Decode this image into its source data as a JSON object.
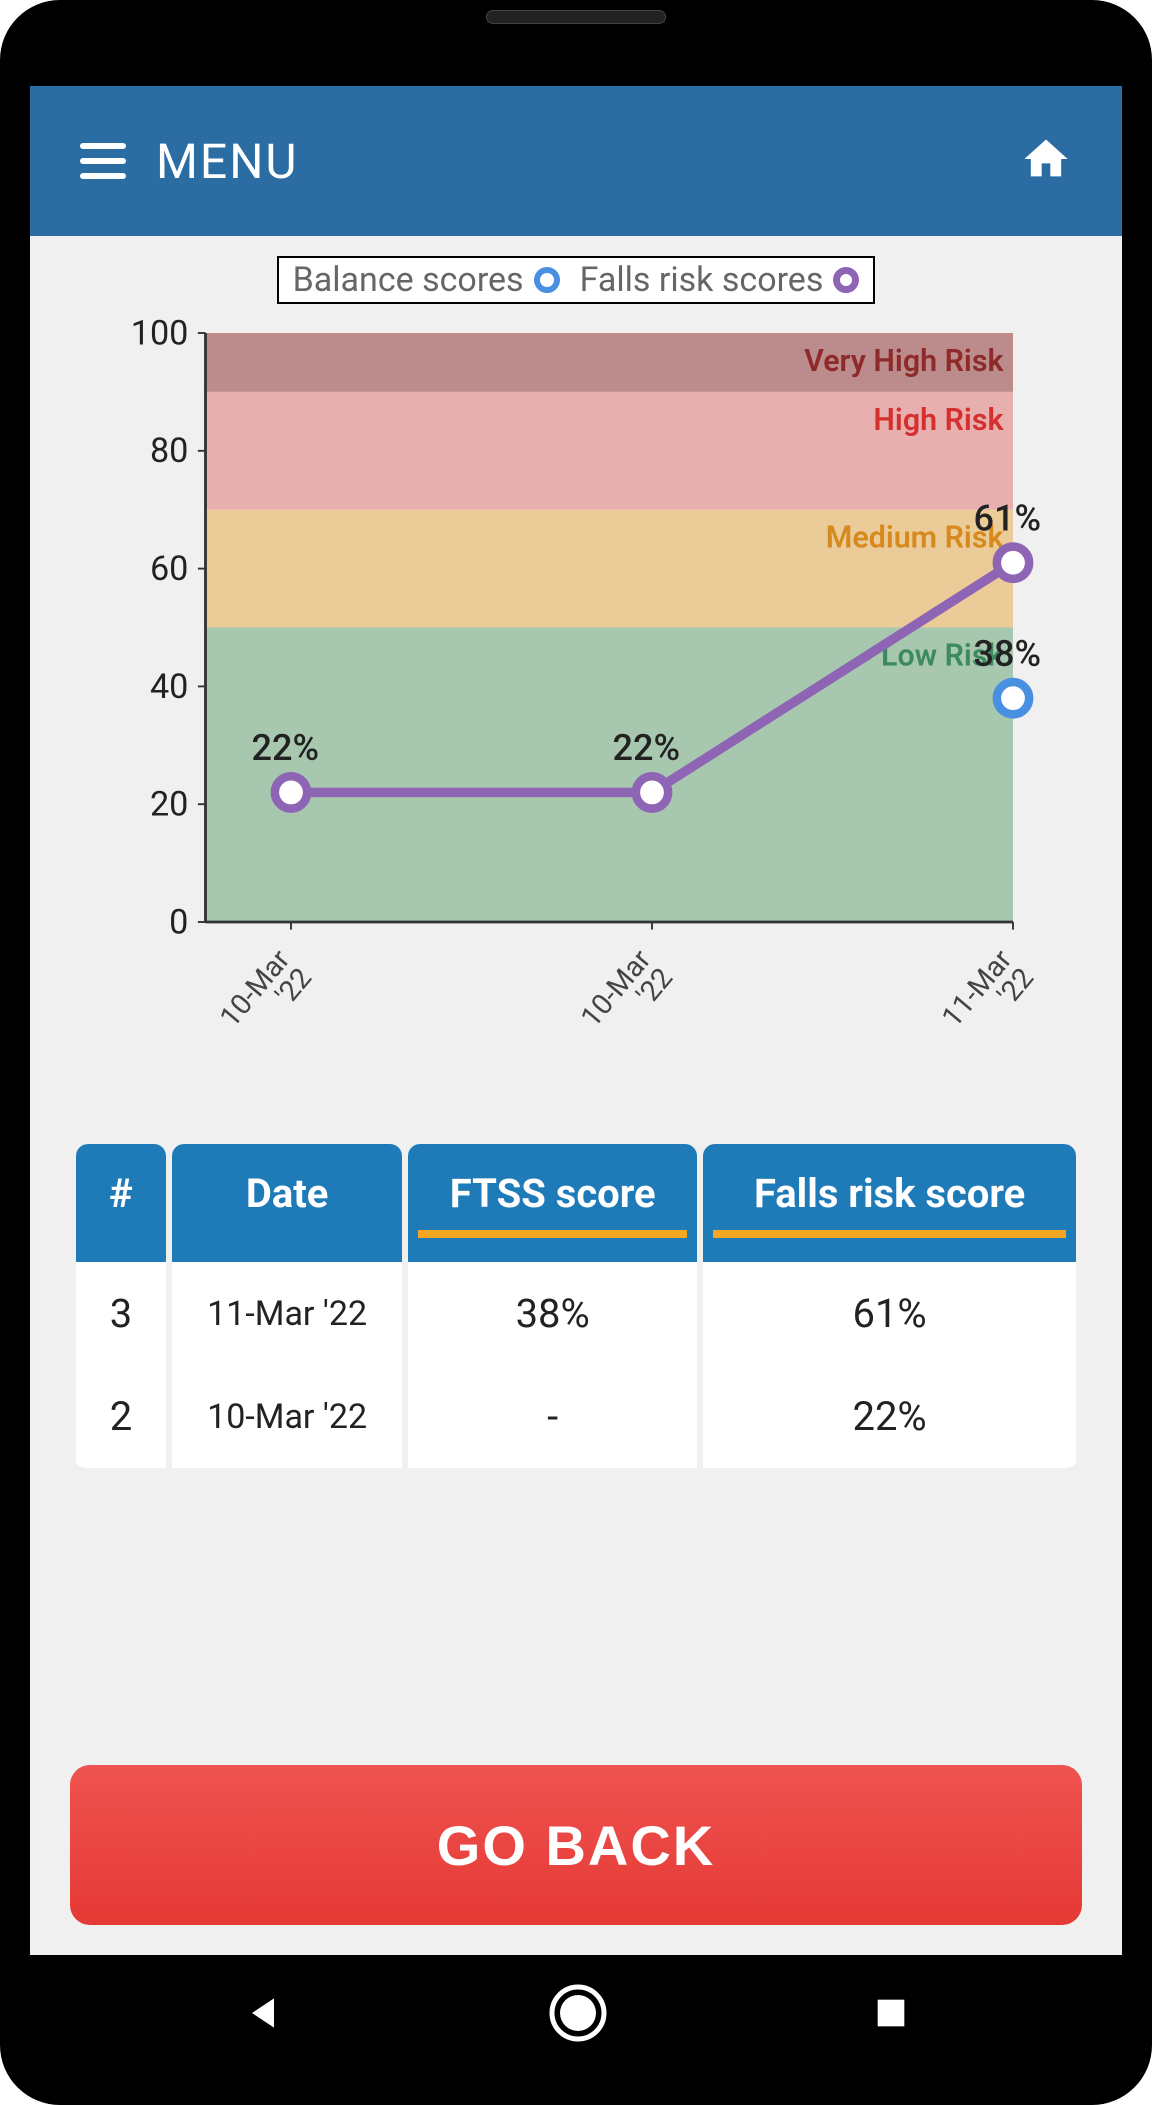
{
  "header": {
    "menu_label": "MENU"
  },
  "legend": {
    "balance_label": "Balance scores",
    "falls_label": "Falls risk scores"
  },
  "chart_data": {
    "type": "line",
    "ylim": [
      0,
      100
    ],
    "y_ticks": [
      0,
      20,
      40,
      60,
      80,
      100
    ],
    "x_ticks": [
      "10-Mar '22",
      "10-Mar '22",
      "11-Mar '22"
    ],
    "series": [
      {
        "name": "Falls risk scores",
        "color": "#8e65b5",
        "values": [
          22,
          22,
          61
        ],
        "labels": [
          "22%",
          "22%",
          "61%"
        ],
        "connected": true
      },
      {
        "name": "Balance scores",
        "color": "#4a90e2",
        "values": [
          null,
          null,
          38
        ],
        "labels": [
          null,
          null,
          "38%"
        ],
        "connected": false
      }
    ],
    "risk_bands": [
      {
        "label": "Very High Risk",
        "from": 90,
        "to": 100,
        "fill": "#ab6b6b",
        "label_color": "#8e2a2a"
      },
      {
        "label": "High Risk",
        "from": 70,
        "to": 90,
        "fill": "#e59a9a",
        "label_color": "#d62f2f"
      },
      {
        "label": "Medium Risk",
        "from": 50,
        "to": 70,
        "fill": "#eabf7a",
        "label_color": "#d68a1d"
      },
      {
        "label": "Low Risk",
        "from": 0,
        "to": 50,
        "fill": "#8fb99a",
        "label_color": "#3b8a60"
      }
    ]
  },
  "table": {
    "headers": {
      "num": "#",
      "date": "Date",
      "ftss": "FTSS score",
      "falls": "Falls risk score"
    },
    "rows": [
      {
        "num": "3",
        "date": "11-Mar '22",
        "ftss": "38%",
        "falls": "61%"
      },
      {
        "num": "2",
        "date": "10-Mar '22",
        "ftss": "-",
        "falls": "22%"
      }
    ]
  },
  "buttons": {
    "go_back": "GO BACK"
  }
}
